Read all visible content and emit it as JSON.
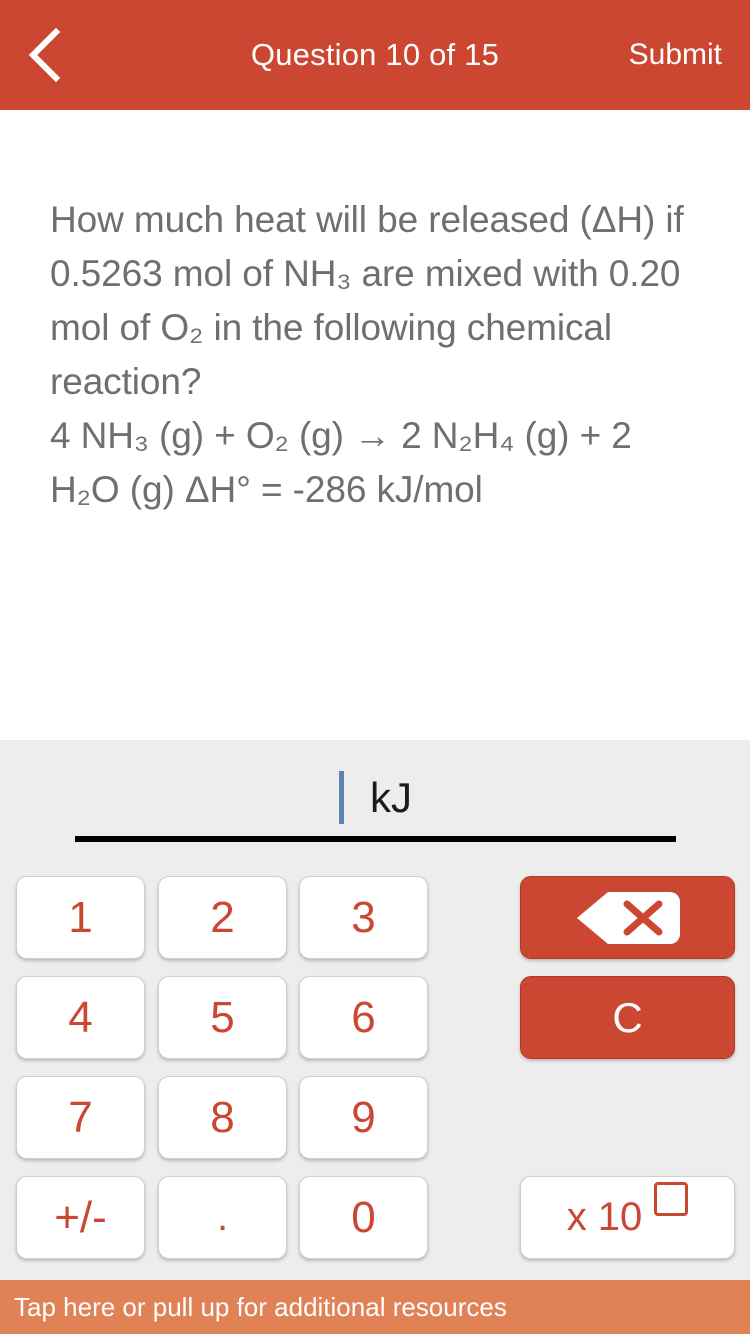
{
  "header": {
    "title": "Question 10 of 15",
    "submit_label": "Submit",
    "back_icon": "chevron-left-icon",
    "background_color": "#cb4731",
    "text_color": "#ffffff"
  },
  "question": {
    "text": "How much heat will be released (ΔH) if 0.5263 mol of NH₃ are mixed with 0.20 mol of O₂ in the following chemical reaction?\n4 NH₃ (g) + O₂ (g) → 2 N₂H₄ (g) + 2 H₂O (g) ΔH° = -286 kJ/mol",
    "text_color": "#6f6f6f"
  },
  "answer": {
    "value": "",
    "unit": "kJ",
    "caret_color": "#5b84b1",
    "underline_color": "#000000"
  },
  "keypad": {
    "background_color": "#ededed",
    "digit_color": "#cb4731",
    "keys": [
      {
        "name": "key-1",
        "label": "1"
      },
      {
        "name": "key-2",
        "label": "2"
      },
      {
        "name": "key-3",
        "label": "3"
      },
      {
        "name": "key-4",
        "label": "4"
      },
      {
        "name": "key-5",
        "label": "5"
      },
      {
        "name": "key-6",
        "label": "6"
      },
      {
        "name": "key-7",
        "label": "7"
      },
      {
        "name": "key-8",
        "label": "8"
      },
      {
        "name": "key-9",
        "label": "9"
      },
      {
        "name": "key-plus-minus",
        "label": "+/-"
      },
      {
        "name": "key-decimal",
        "label": "."
      },
      {
        "name": "key-0",
        "label": "0"
      }
    ],
    "backspace": {
      "icon": "backspace-icon",
      "label": ""
    },
    "clear": {
      "label": "C"
    },
    "exponent": {
      "label": "x 10",
      "placeholder_icon": "empty-square-placeholder"
    }
  },
  "resources": {
    "label": "Tap here or pull up for additional resources",
    "background_color": "#e08156"
  }
}
